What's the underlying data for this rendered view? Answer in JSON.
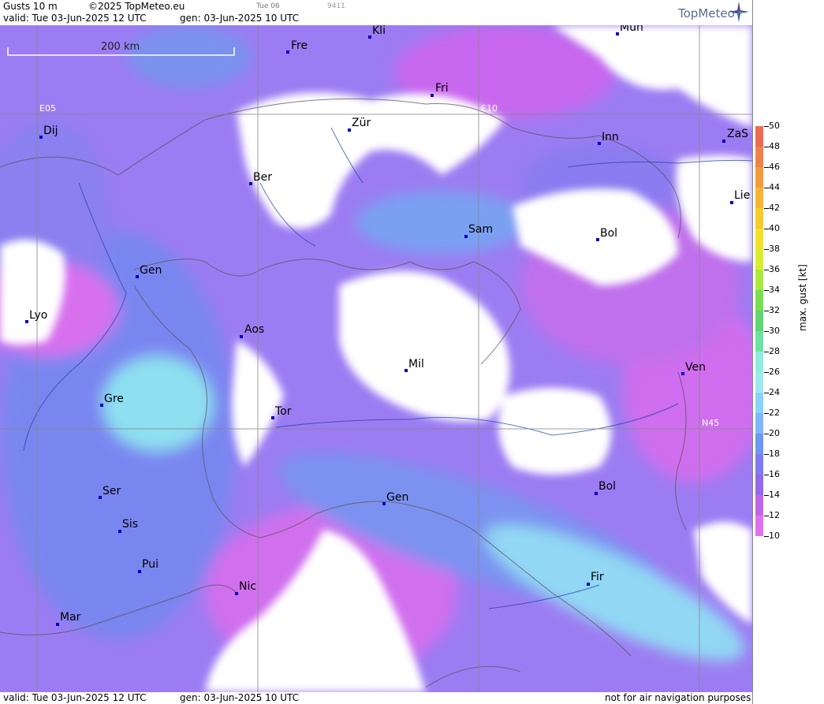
{
  "header": {
    "product": "Gusts 10 m",
    "copyright": "©2025 TopMeteo.eu",
    "valid_line": "valid:  Tue  03-Jun-2025  12 UTC",
    "gen_line": "gen:  03-Jun-2025 10 UTC",
    "day_tab": "Tue 06",
    "code": "9411",
    "brand": "TopMeteo"
  },
  "footer": {
    "valid_line": "valid:  Tue  03-Jun-2025  12 UTC",
    "gen_line": "gen:  03-Jun-2025 10 UTC",
    "disclaimer": "not for air navigation purposes"
  },
  "scale_label": "200 km",
  "grid_labels": {
    "e05": "E05",
    "e10": "E10",
    "n45": "N45"
  },
  "legend": {
    "unit": "max. gust [kt]",
    "labels": [
      "50",
      "48",
      "46",
      "44",
      "42",
      "40",
      "38",
      "36",
      "34",
      "32",
      "30",
      "28",
      "26",
      "24",
      "22",
      "20",
      "18",
      "16",
      "14",
      "12",
      "10"
    ],
    "colors": [
      "#ee6a50",
      "#f08048",
      "#f39a3c",
      "#f6b431",
      "#f7cc2a",
      "#f4e126",
      "#d8ee2c",
      "#a8ea3c",
      "#78e050",
      "#5fd670",
      "#6ae3a0",
      "#8fece0",
      "#9ee8f0",
      "#88d4f8",
      "#7eb8fa",
      "#6e96f4",
      "#7e7af0",
      "#9668ec",
      "#c064ea",
      "#e070ee"
    ]
  },
  "cities": [
    {
      "name": "Kli"
    },
    {
      "name": "Mun"
    },
    {
      "name": "Fre"
    },
    {
      "name": "Fri"
    },
    {
      "name": "Dij"
    },
    {
      "name": "Zür"
    },
    {
      "name": "Inn"
    },
    {
      "name": "ZaS"
    },
    {
      "name": "Ber"
    },
    {
      "name": "Lie"
    },
    {
      "name": "Sam"
    },
    {
      "name": "Bol"
    },
    {
      "name": "Gen"
    },
    {
      "name": "Lyo"
    },
    {
      "name": "Aos"
    },
    {
      "name": "Ven"
    },
    {
      "name": "Mil"
    },
    {
      "name": "Gre"
    },
    {
      "name": "Tor"
    },
    {
      "name": "Ser"
    },
    {
      "name": "Gen"
    },
    {
      "name": "Bol"
    },
    {
      "name": "Sis"
    },
    {
      "name": "Pui"
    },
    {
      "name": "Nic"
    },
    {
      "name": "Fir"
    },
    {
      "name": "Mar"
    }
  ]
}
